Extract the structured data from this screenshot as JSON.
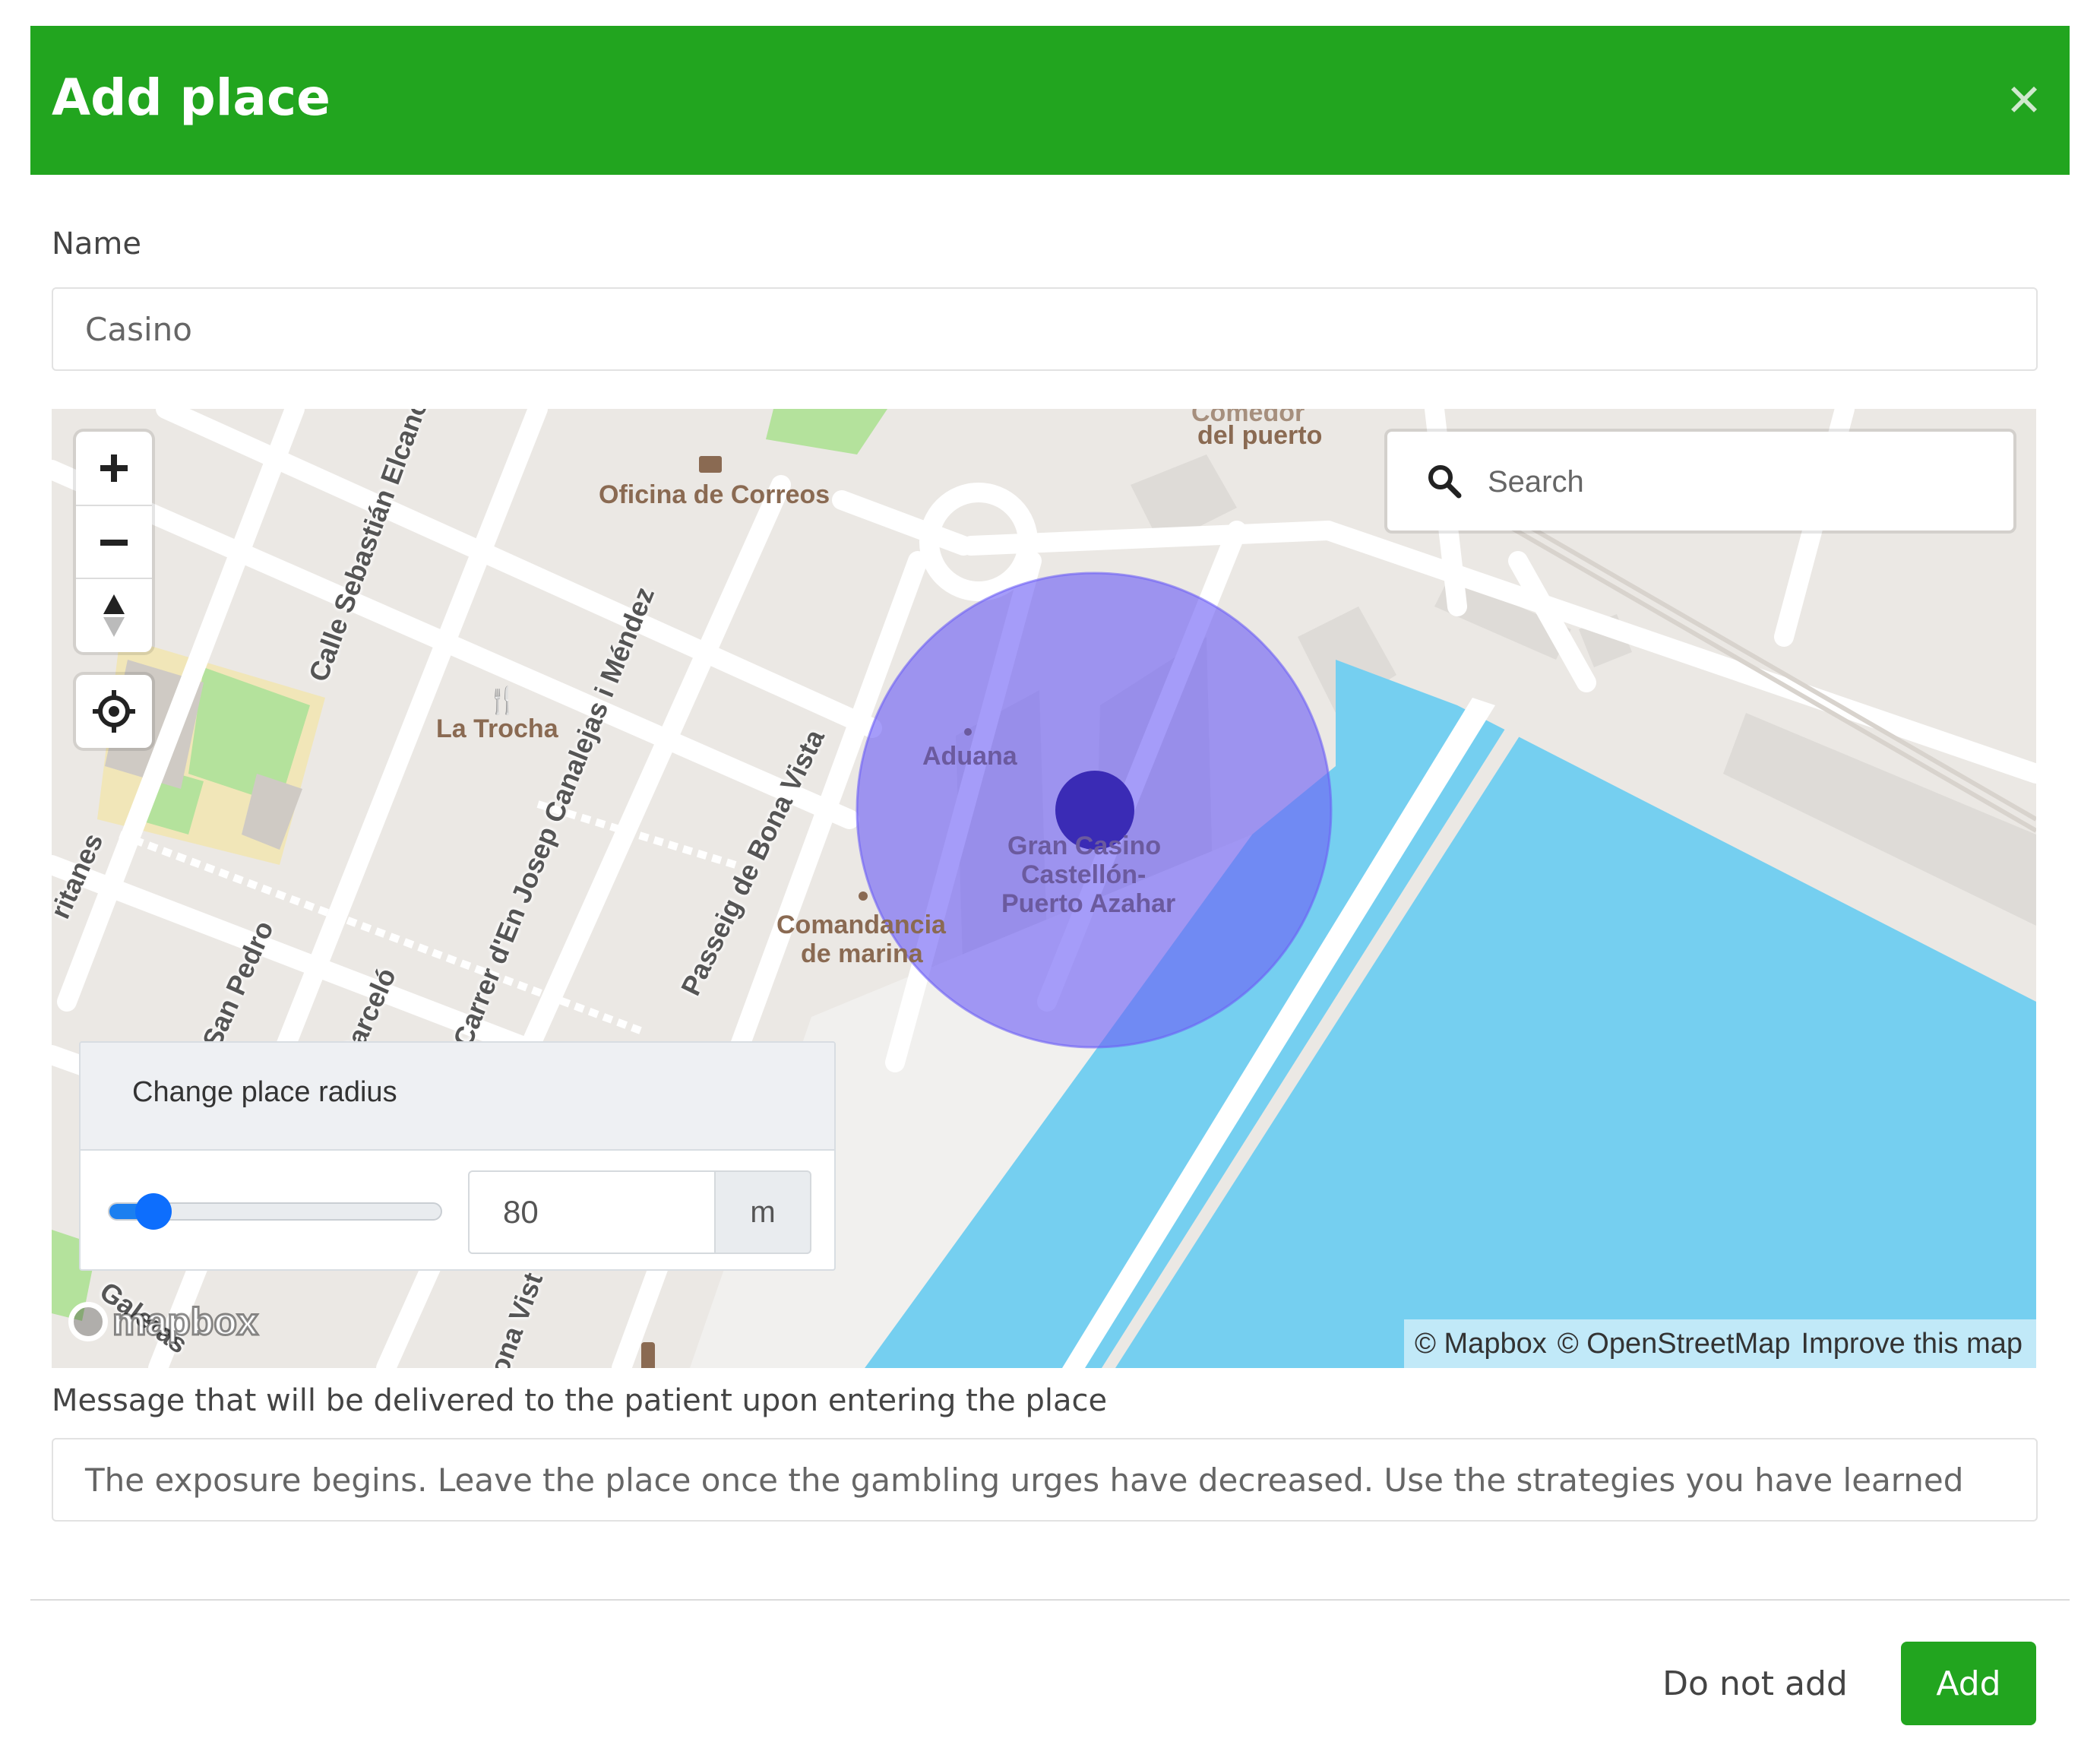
{
  "dialog": {
    "title": "Add place",
    "close_icon": "close-icon",
    "header_color": "#22a51f"
  },
  "name_field": {
    "label": "Name",
    "value": "Casino"
  },
  "map": {
    "search": {
      "placeholder": "Search",
      "icon": "search-icon"
    },
    "controls": {
      "zoom_in_icon": "plus-icon",
      "zoom_out_icon": "minus-icon",
      "compass_icon": "compass-icon",
      "geolocate_icon": "crosshair-icon"
    },
    "labels": {
      "correos": "Oficina de Correos",
      "puerto_line1": "Comedor",
      "puerto_line2": "del puerto",
      "la_trocha": "La Trocha",
      "aduana": "Aduana",
      "gran_casino_1": "Gran Casino",
      "gran_casino_2": "Castellón-",
      "gran_casino_3": "Puerto Azahar",
      "comandancia_1": "Comandancia",
      "comandancia_2": "de marina",
      "street_elcano": "Calle Sebastián Elcano",
      "street_canalejas": "Carrer d'En Josep Canalejas i Méndez",
      "street_bona_vista": "Passeig de Bona Vista",
      "street_san_pedro": "San Pedro",
      "street_barcelo": "Barceló",
      "street_ritanes": "ritanes",
      "street_galeras": "Galeras",
      "street_bona_vista_2": "ona Vist"
    },
    "radius_circle_color": "#7b6ff7",
    "water_color": "#75cff0",
    "attribution": {
      "mapbox": "© Mapbox",
      "osm": "© OpenStreetMap",
      "improve": "Improve this map"
    },
    "logo_text": "mapbox"
  },
  "radius_control": {
    "title": "Change place radius",
    "value": "80",
    "unit": "m",
    "slider_fraction": 0.09
  },
  "message_field": {
    "label": "Message that will be delivered to the patient upon entering the place",
    "value": "The exposure begins. Leave the place once the gambling urges have decreased. Use the strategies you have learned"
  },
  "footer": {
    "cancel_label": "Do not add",
    "add_label": "Add"
  }
}
